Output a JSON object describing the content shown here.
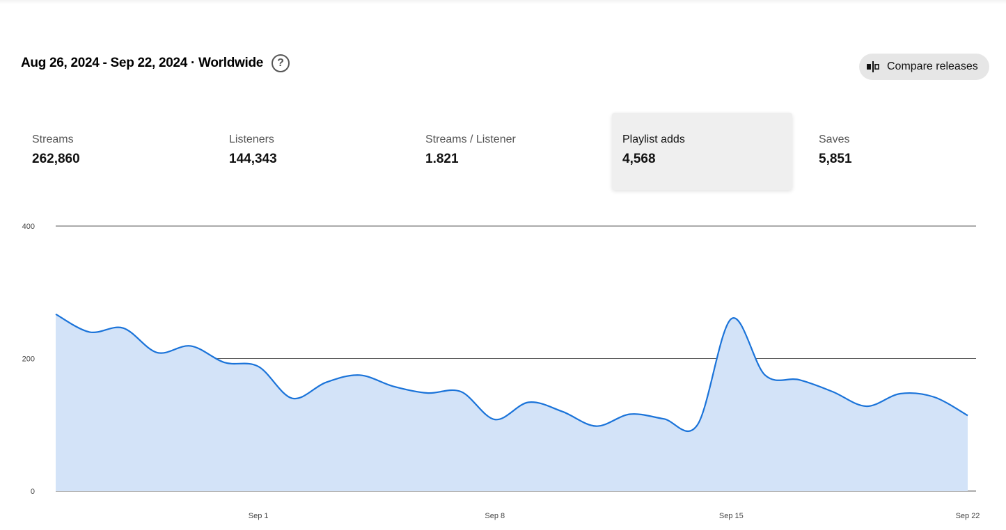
{
  "header": {
    "title": "Aug 26, 2024 - Sep 22, 2024 · Worldwide",
    "help_icon": "question-circle-icon"
  },
  "compare_button": {
    "label": "Compare releases",
    "icon": "compare-icon"
  },
  "metrics": [
    {
      "label": "Streams",
      "value": "262,860",
      "active": false
    },
    {
      "label": "Listeners",
      "value": "144,343",
      "active": false
    },
    {
      "label": "Streams / Listener",
      "value": "1.821",
      "active": false
    },
    {
      "label": "Playlist adds",
      "value": "4,568",
      "active": true
    },
    {
      "label": "Saves",
      "value": "5,851",
      "active": false
    }
  ],
  "colors": {
    "line": "#1a73d9",
    "area": "#d3e3f8",
    "gridline": "#555555",
    "active_tab_bg": "#efefef"
  },
  "chart_data": {
    "type": "area",
    "title": "",
    "xlabel": "",
    "ylabel": "",
    "ylim": [
      0,
      400
    ],
    "yticks": [
      "0",
      "200",
      "400"
    ],
    "xtick_labels": [
      {
        "label": "Sep 1",
        "x": "2024-09-01"
      },
      {
        "label": "Sep 8",
        "x": "2024-09-08"
      },
      {
        "label": "Sep 15",
        "x": "2024-09-15"
      },
      {
        "label": "Sep 22",
        "x": "2024-09-22"
      }
    ],
    "grid": true,
    "x": [
      "2024-08-26",
      "2024-08-27",
      "2024-08-28",
      "2024-08-29",
      "2024-08-30",
      "2024-08-31",
      "2024-09-01",
      "2024-09-02",
      "2024-09-03",
      "2024-09-04",
      "2024-09-05",
      "2024-09-06",
      "2024-09-07",
      "2024-09-08",
      "2024-09-09",
      "2024-09-10",
      "2024-09-11",
      "2024-09-12",
      "2024-09-13",
      "2024-09-14",
      "2024-09-15",
      "2024-09-16",
      "2024-09-17",
      "2024-09-18",
      "2024-09-19",
      "2024-09-20",
      "2024-09-21",
      "2024-09-22"
    ],
    "series": [
      {
        "values": [
          267,
          240,
          246,
          209,
          219,
          194,
          188,
          140,
          164,
          175,
          158,
          148,
          150,
          108,
          134,
          120,
          98,
          116,
          109,
          100,
          260,
          175,
          168,
          150,
          128,
          147,
          142,
          114
        ]
      }
    ]
  }
}
